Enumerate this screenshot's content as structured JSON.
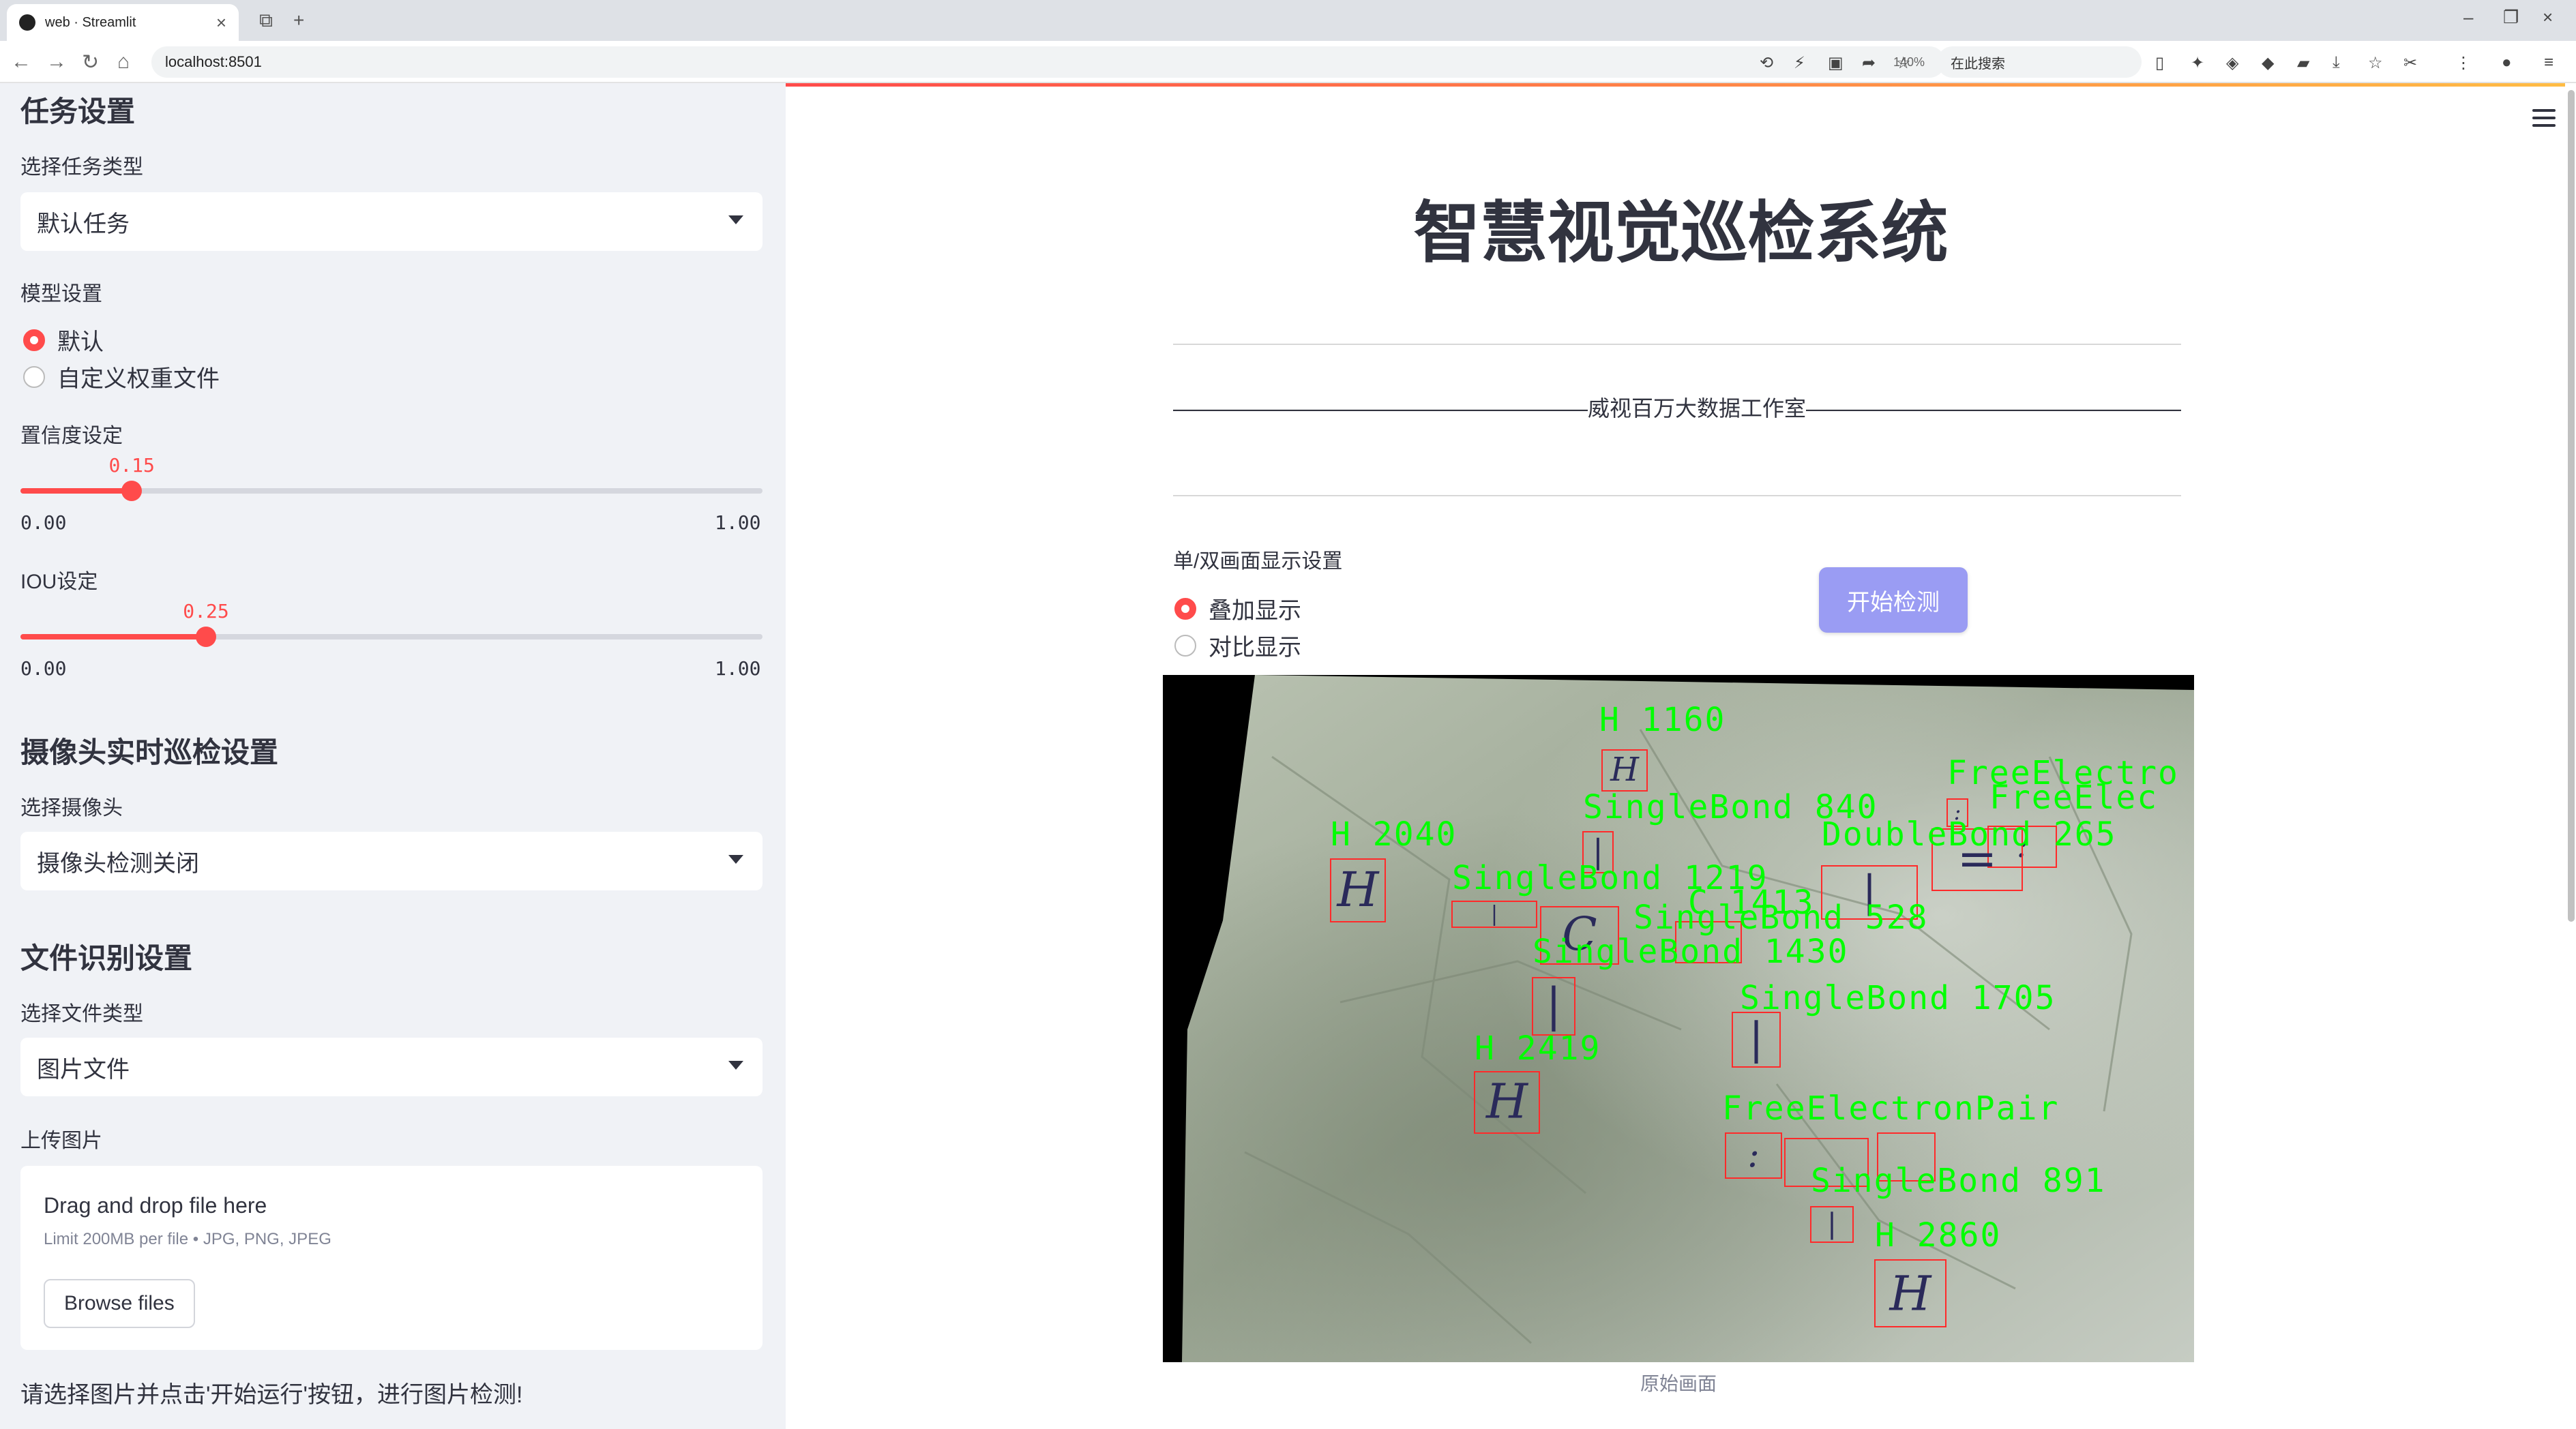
{
  "browser": {
    "tab_title": "web · Streamlit",
    "url": "localhost:8501",
    "zoom": "140%",
    "search_placeholder": "在此搜索"
  },
  "sidebar": {
    "task_heading": "任务设置",
    "task_type_label": "选择任务类型",
    "task_type_value": "默认任务",
    "model_label": "模型设置",
    "model_options": [
      "默认",
      "自定义权重文件"
    ],
    "confidence_label": "置信度设定",
    "confidence": {
      "value": "0.15",
      "value_num": 0.15,
      "min": "0.00",
      "max": "1.00"
    },
    "iou_label": "IOU设定",
    "iou": {
      "value": "0.25",
      "value_num": 0.25,
      "min": "0.00",
      "max": "1.00"
    },
    "camera_heading": "摄像头实时巡检设置",
    "camera_label": "选择摄像头",
    "camera_value": "摄像头检测关闭",
    "file_heading": "文件识别设置",
    "file_type_label": "选择文件类型",
    "file_type_value": "图片文件",
    "upload_label": "上传图片",
    "upload_drag": "Drag and drop file here",
    "upload_limit": "Limit 200MB per file • JPG, PNG, JPEG",
    "upload_button": "Browse files",
    "note": "请选择图片并点击'开始运行'按钮，进行图片检测!"
  },
  "main": {
    "title": "智慧视觉巡检系统",
    "subtitle": "———————————————————威视百万大数据工作室————————————————————",
    "display_label": "单/双画面显示设置",
    "display_options": [
      "叠加显示",
      "对比显示"
    ],
    "detect_button": "开始检测",
    "image_caption": "原始画面"
  },
  "detections": [
    {
      "label": "H 1160"
    },
    {
      "label": "SingleBond 840"
    },
    {
      "label": "FreeElectro"
    },
    {
      "label": "FreeElec"
    },
    {
      "label": "H 2040"
    },
    {
      "label": "DoubleBond 265"
    },
    {
      "label": "SingleBond 1219"
    },
    {
      "label": "C 1413"
    },
    {
      "label": "SingleBond 528"
    },
    {
      "label": "SingleBond 1430"
    },
    {
      "label": "SingleBond 1705"
    },
    {
      "label": "H 2419"
    },
    {
      "label": "FreeElectronPair"
    },
    {
      "label": "SingleBond 891"
    },
    {
      "label": "H 2860"
    }
  ],
  "colors": {
    "accent": "#ff4b4b",
    "detect_button": "#9a9cf3",
    "detection_text": "#00ff00",
    "detection_box": "#ff2a2a"
  }
}
